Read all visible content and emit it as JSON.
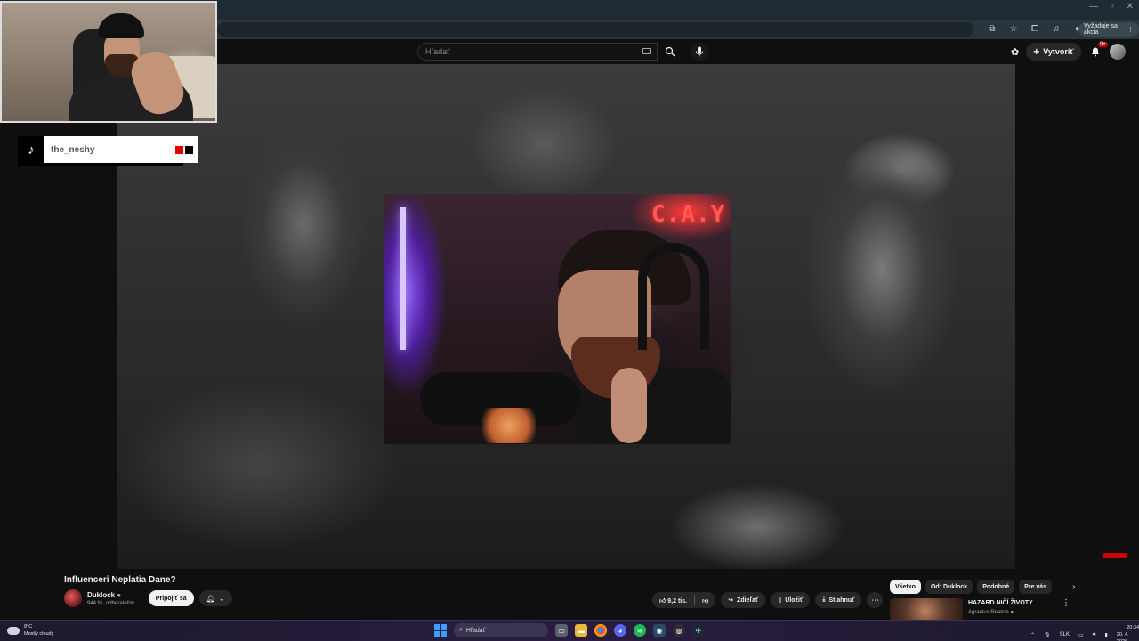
{
  "browser": {
    "action_pill": "Vyžaduje sa akcia",
    "window_controls": [
      "—",
      "▫",
      "✕"
    ]
  },
  "youtube": {
    "search": {
      "placeholder": "Hľadať"
    },
    "create_label": "Vytvoriť",
    "notifications_badge": "9+",
    "video": {
      "title": "Influenceri Neplatia Dane?",
      "neon_text": "C.A.Y"
    },
    "channel": {
      "name": "Duklock",
      "subscribers": "944 tis. odberateľov",
      "join_label": "Pripojiť sa"
    },
    "actions": {
      "likes": "9,2 tis.",
      "share_label": "Zdieľať",
      "save_label": "Uložiť",
      "download_label": "Stiahnuť",
      "more": "⋯"
    },
    "chips": [
      "Všetko",
      "Od: Duklock",
      "Podobné",
      "Pre vás"
    ],
    "recommendation": {
      "title": "HAZARD NIČÍ ŽIVOTY",
      "channel": "Agraelus Reakce"
    }
  },
  "overlay": {
    "tiktok_handle": "the_neshy",
    "tiktok_logo": "♪",
    "square_colors": [
      "#e00000",
      "#000000"
    ]
  },
  "taskbar": {
    "weather_temp": "8°C",
    "weather_desc": "Mostly cloudy",
    "search_label": "Hľadať",
    "language": "SLK",
    "time": "20:34",
    "date": "20. 4. 2026"
  }
}
